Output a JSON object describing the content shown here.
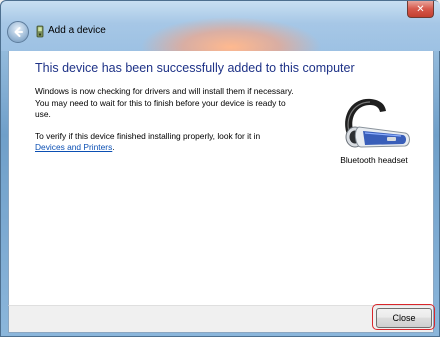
{
  "window": {
    "title": "Add a device",
    "close_glyph": "✕"
  },
  "content": {
    "heading": "This device has been successfully added to this computer",
    "paragraph1": "Windows is now checking for drivers and will install them if necessary. You may need to wait for this to finish before your device is ready to use.",
    "paragraph2_prefix": "To verify if this device finished installing properly, look for it in",
    "paragraph2_link": "Devices and Printers",
    "paragraph2_suffix": "."
  },
  "device": {
    "label": "Bluetooth headset",
    "icon": "bluetooth-headset-icon"
  },
  "footer": {
    "close_label": "Close"
  },
  "colors": {
    "heading": "#1e3287",
    "link": "#0b4fb3",
    "highlight": "#d9262b"
  }
}
